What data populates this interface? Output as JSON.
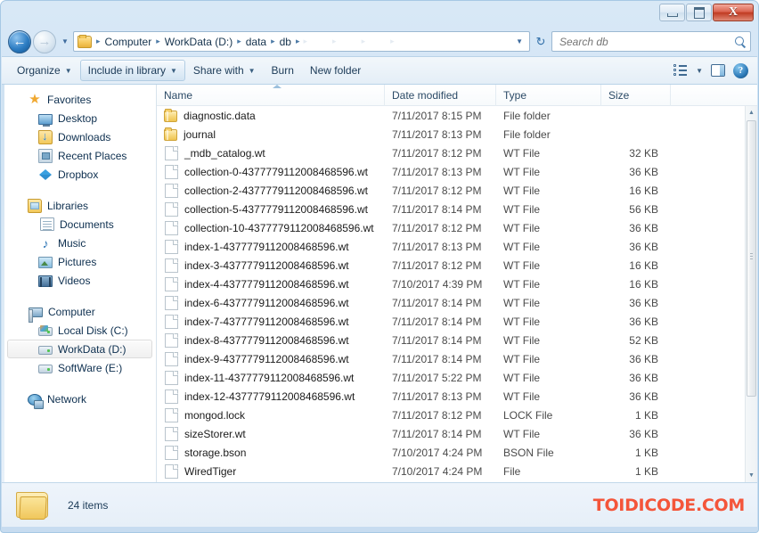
{
  "window": {
    "titlebar": {
      "minimize_label": "",
      "maximize_label": "",
      "close_label": "X"
    }
  },
  "navbar": {
    "back_glyph": "←",
    "forward_glyph": "→",
    "history_caret": "▼",
    "breadcrumb": {
      "items": [
        "Computer",
        "WorkData (D:)",
        "data",
        "db"
      ],
      "separator": "▸",
      "ghost_separators": [
        "▸",
        "▸",
        "▸",
        "▸"
      ],
      "dropdown_caret": "▼"
    },
    "refresh_glyph": "↻",
    "search": {
      "placeholder": "Search db",
      "value": ""
    }
  },
  "commandbar": {
    "buttons": [
      {
        "label": "Organize",
        "has_arrow": true,
        "active": false
      },
      {
        "label": "Include in library",
        "has_arrow": true,
        "active": true
      },
      {
        "label": "Share with",
        "has_arrow": true,
        "active": false
      },
      {
        "label": "Burn",
        "has_arrow": false,
        "active": false
      },
      {
        "label": "New folder",
        "has_arrow": false,
        "active": false
      }
    ],
    "arrow_glyph": "▼",
    "view_dropdown_caret": "▼",
    "help_label": "?"
  },
  "sidebar": {
    "groups": [
      {
        "header": {
          "label": "Favorites",
          "icon": "star-icon"
        },
        "items": [
          {
            "label": "Desktop",
            "icon": "desktop-icon"
          },
          {
            "label": "Downloads",
            "icon": "downloads-icon"
          },
          {
            "label": "Recent Places",
            "icon": "recent-places-icon"
          },
          {
            "label": "Dropbox",
            "icon": "dropbox-icon"
          }
        ]
      },
      {
        "header": {
          "label": "Libraries",
          "icon": "libraries-icon"
        },
        "items": [
          {
            "label": "Documents",
            "icon": "documents-icon"
          },
          {
            "label": "Music",
            "icon": "music-icon"
          },
          {
            "label": "Pictures",
            "icon": "pictures-icon"
          },
          {
            "label": "Videos",
            "icon": "videos-icon"
          }
        ]
      },
      {
        "header": {
          "label": "Computer",
          "icon": "computer-icon"
        },
        "items": [
          {
            "label": "Local Disk (C:)",
            "icon": "windows-drive-icon",
            "selected": false
          },
          {
            "label": "WorkData (D:)",
            "icon": "drive-icon",
            "selected": true
          },
          {
            "label": "SoftWare (E:)",
            "icon": "drive-icon",
            "selected": false
          }
        ]
      },
      {
        "header": {
          "label": "Network",
          "icon": "network-icon"
        },
        "items": []
      }
    ]
  },
  "filelist": {
    "columns": [
      {
        "key": "name",
        "label": "Name",
        "sorted": true,
        "sort_direction": "asc"
      },
      {
        "key": "date",
        "label": "Date modified"
      },
      {
        "key": "type",
        "label": "Type"
      },
      {
        "key": "size",
        "label": "Size"
      }
    ],
    "rows": [
      {
        "name": "diagnostic.data",
        "date": "7/11/2017 8:15 PM",
        "type": "File folder",
        "size": "",
        "icon": "folder-icon"
      },
      {
        "name": "journal",
        "date": "7/11/2017 8:13 PM",
        "type": "File folder",
        "size": "",
        "icon": "folder-icon"
      },
      {
        "name": "_mdb_catalog.wt",
        "date": "7/11/2017 8:12 PM",
        "type": "WT File",
        "size": "32 KB",
        "icon": "file-icon"
      },
      {
        "name": "collection-0-4377779112008468596.wt",
        "date": "7/11/2017 8:13 PM",
        "type": "WT File",
        "size": "36 KB",
        "icon": "file-icon"
      },
      {
        "name": "collection-2-4377779112008468596.wt",
        "date": "7/11/2017 8:12 PM",
        "type": "WT File",
        "size": "16 KB",
        "icon": "file-icon"
      },
      {
        "name": "collection-5-4377779112008468596.wt",
        "date": "7/11/2017 8:14 PM",
        "type": "WT File",
        "size": "56 KB",
        "icon": "file-icon"
      },
      {
        "name": "collection-10-4377779112008468596.wt",
        "date": "7/11/2017 8:12 PM",
        "type": "WT File",
        "size": "36 KB",
        "icon": "file-icon"
      },
      {
        "name": "index-1-4377779112008468596.wt",
        "date": "7/11/2017 8:13 PM",
        "type": "WT File",
        "size": "36 KB",
        "icon": "file-icon"
      },
      {
        "name": "index-3-4377779112008468596.wt",
        "date": "7/11/2017 8:12 PM",
        "type": "WT File",
        "size": "16 KB",
        "icon": "file-icon"
      },
      {
        "name": "index-4-4377779112008468596.wt",
        "date": "7/10/2017 4:39 PM",
        "type": "WT File",
        "size": "16 KB",
        "icon": "file-icon"
      },
      {
        "name": "index-6-4377779112008468596.wt",
        "date": "7/11/2017 8:14 PM",
        "type": "WT File",
        "size": "36 KB",
        "icon": "file-icon"
      },
      {
        "name": "index-7-4377779112008468596.wt",
        "date": "7/11/2017 8:14 PM",
        "type": "WT File",
        "size": "36 KB",
        "icon": "file-icon"
      },
      {
        "name": "index-8-4377779112008468596.wt",
        "date": "7/11/2017 8:14 PM",
        "type": "WT File",
        "size": "52 KB",
        "icon": "file-icon"
      },
      {
        "name": "index-9-4377779112008468596.wt",
        "date": "7/11/2017 8:14 PM",
        "type": "WT File",
        "size": "36 KB",
        "icon": "file-icon"
      },
      {
        "name": "index-11-4377779112008468596.wt",
        "date": "7/11/2017 5:22 PM",
        "type": "WT File",
        "size": "36 KB",
        "icon": "file-icon"
      },
      {
        "name": "index-12-4377779112008468596.wt",
        "date": "7/11/2017 8:13 PM",
        "type": "WT File",
        "size": "36 KB",
        "icon": "file-icon"
      },
      {
        "name": "mongod.lock",
        "date": "7/11/2017 8:12 PM",
        "type": "LOCK File",
        "size": "1 KB",
        "icon": "file-icon"
      },
      {
        "name": "sizeStorer.wt",
        "date": "7/11/2017 8:14 PM",
        "type": "WT File",
        "size": "36 KB",
        "icon": "file-icon"
      },
      {
        "name": "storage.bson",
        "date": "7/10/2017 4:24 PM",
        "type": "BSON File",
        "size": "1 KB",
        "icon": "file-icon"
      },
      {
        "name": "WiredTiger",
        "date": "7/10/2017 4:24 PM",
        "type": "File",
        "size": "1 KB",
        "icon": "file-icon"
      }
    ],
    "scrollbar": {
      "up_glyph": "▲",
      "down_glyph": "▼"
    }
  },
  "statusbar": {
    "item_count_text": "24 items",
    "watermark": "TOIDICODE.COM"
  },
  "colors": {
    "window_frame": "#c7dcf0",
    "close_button": "#c03a22",
    "watermark": "#f4553a",
    "selection": "#f0f0f0",
    "folder_yellow": "#f2c85b"
  }
}
